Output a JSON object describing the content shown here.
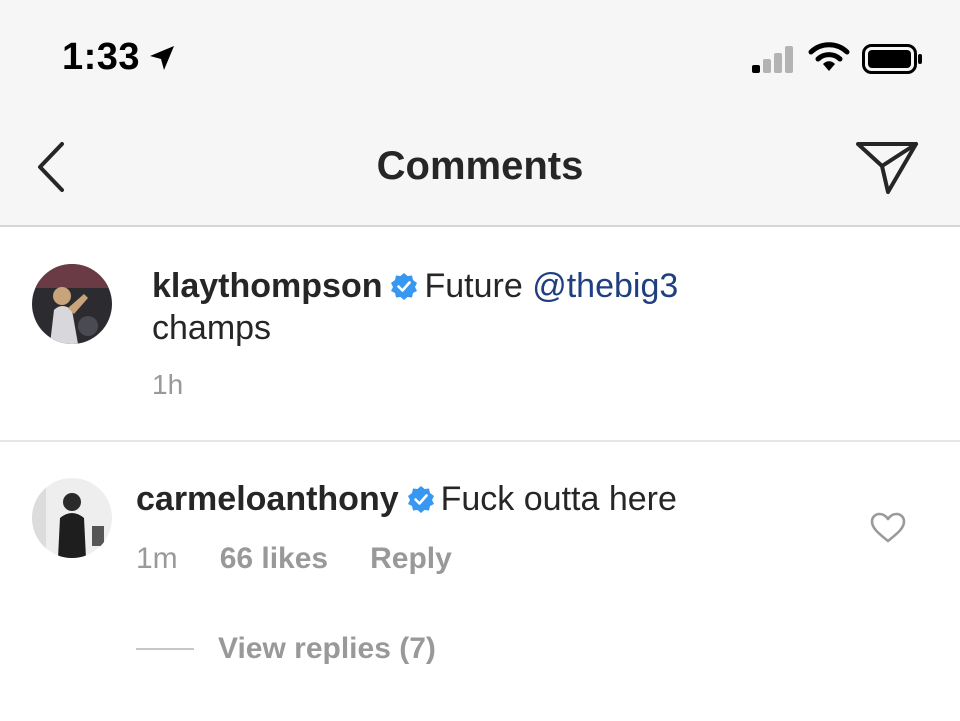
{
  "status_bar": {
    "time": "1:33",
    "icons": [
      "location-arrow-icon",
      "cellular-signal-icon",
      "wifi-icon",
      "battery-icon"
    ]
  },
  "nav": {
    "title": "Comments",
    "back_icon": "chevron-left-icon",
    "share_icon": "paper-plane-icon"
  },
  "caption": {
    "username": "klaythompson",
    "verified": true,
    "text_before": "Future",
    "mention": "@thebig3",
    "text_after": "champs",
    "time": "1h"
  },
  "comment": {
    "username": "carmeloanthony",
    "verified": true,
    "text": "Fuck outta here",
    "time": "1m",
    "likes": "66 likes",
    "reply_label": "Reply",
    "view_replies_label": "View replies (7)"
  },
  "colors": {
    "bar_background": "#f6f6f6",
    "verified_blue": "#3897f0",
    "mention_blue": "#1f3f80",
    "meta_grey": "#999999",
    "text": "#262626"
  }
}
